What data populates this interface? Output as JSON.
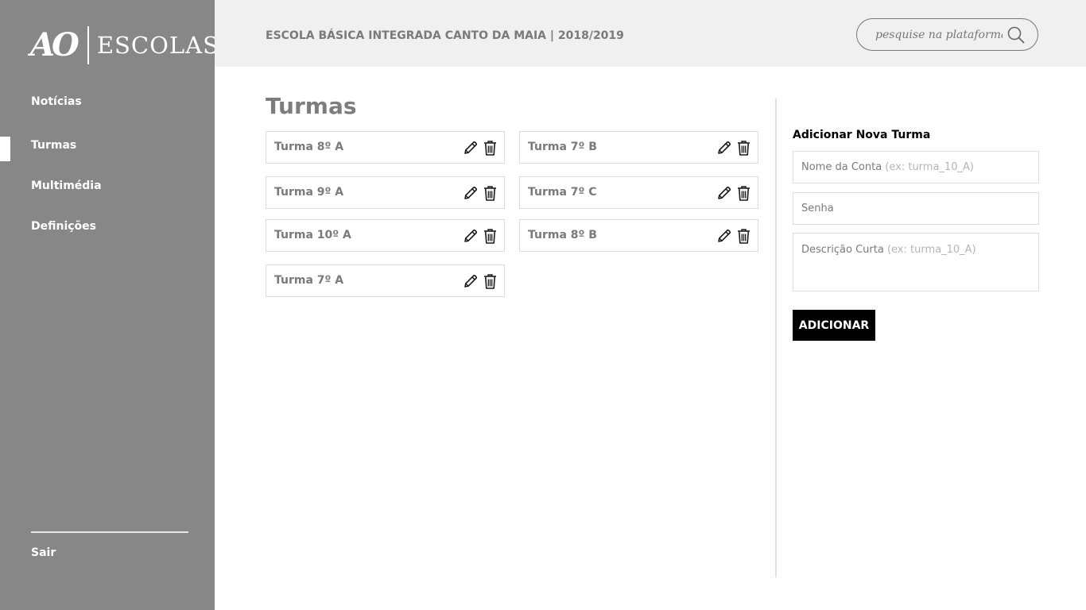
{
  "sidebar": {
    "logo": {
      "mark": "AO",
      "text": "ESCOLAS"
    },
    "items": [
      {
        "label": "Notícias"
      },
      {
        "label": "Turmas"
      },
      {
        "label": "Multimédia"
      },
      {
        "label": "Definições"
      }
    ],
    "active_index": 1,
    "logout_label": "Sair"
  },
  "header": {
    "school": "ESCOLA BÁSICA INTEGRADA CANTO DA MAIA  | 2018/2019",
    "search_placeholder": "pesquise na plataforma",
    "search_icon": "search-icon"
  },
  "main": {
    "title": "Turmas",
    "classes": [
      {
        "label": "Turma 8º A"
      },
      {
        "label": "Turma 7º B"
      },
      {
        "label": "Turma 9º A"
      },
      {
        "label": "Turma 7º C"
      },
      {
        "label": "Turma 10º A"
      },
      {
        "label": "Turma 8º B"
      },
      {
        "label": "Turma 7º A"
      }
    ],
    "edit_icon": "pencil-icon",
    "delete_icon": "trash-icon"
  },
  "form": {
    "title": "Adicionar Nova Turma",
    "account_label": "Nome da Conta",
    "account_hint": "(ex: turma_10_A)",
    "password_label": "Senha",
    "description_label": "Descrição Curta",
    "description_hint": "(ex: turma_10_A)",
    "submit_label": "ADICIONAR"
  },
  "colors": {
    "sidebar_bg": "#878787",
    "header_bg": "#f0f0f0",
    "button_bg": "#000000"
  }
}
